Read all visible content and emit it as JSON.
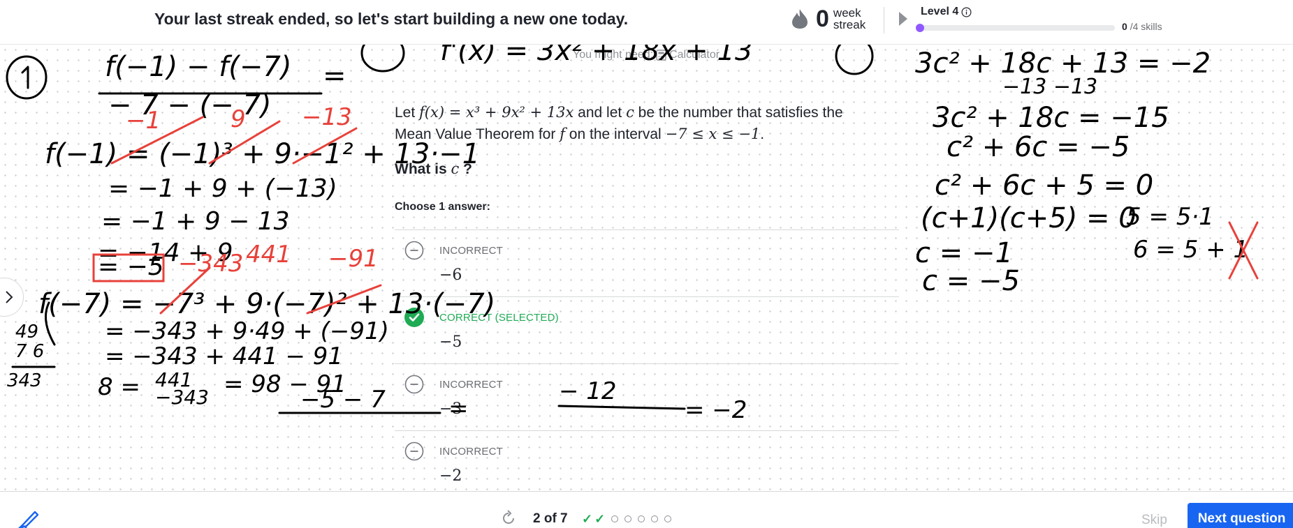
{
  "header": {
    "streak_message": "Your last streak ended, so let's start building a new one today.",
    "streak_count": "0",
    "streak_unit_line1": "week",
    "streak_unit_line2": "streak",
    "level_label": "Level 4",
    "skills_done": "0",
    "skills_total": "/4 skills",
    "level_progress": 0
  },
  "calculator_hint": {
    "text_before": "You might need:",
    "text_after": "Calculator"
  },
  "problem": {
    "intro": "Let ",
    "f_of_x": "f(x)",
    "equals": " = ",
    "expression": "x³ + 9x² + 13x",
    "mid_text": " and let ",
    "c_var": "c",
    "line1_end": " be the number that satisfies the",
    "line2_start": "Mean Value Theorem for ",
    "f_var": "f",
    "line2_mid": " on the interval ",
    "interval": "−7 ≤ x ≤ −1",
    "line2_end": ".",
    "question_before": "What is ",
    "question_var": "c",
    "question_after": " ?",
    "choose_label": "Choose 1 answer:"
  },
  "answers": [
    {
      "status": "INCORRECT",
      "value": "−6",
      "state": "incorrect"
    },
    {
      "status": "CORRECT (SELECTED)",
      "value": "−5",
      "state": "correct"
    },
    {
      "status": "INCORRECT",
      "value": "−3",
      "state": "incorrect"
    },
    {
      "status": "INCORRECT",
      "value": "−2",
      "state": "incorrect"
    }
  ],
  "footer": {
    "counter": "2 of 7",
    "skip_label": "Skip",
    "next_label": "Next question"
  },
  "colors": {
    "primary": "#1865f2",
    "correct": "#1fab54",
    "level": "#9059ff",
    "ink": "#000000",
    "ink_red": "#e8413a"
  }
}
